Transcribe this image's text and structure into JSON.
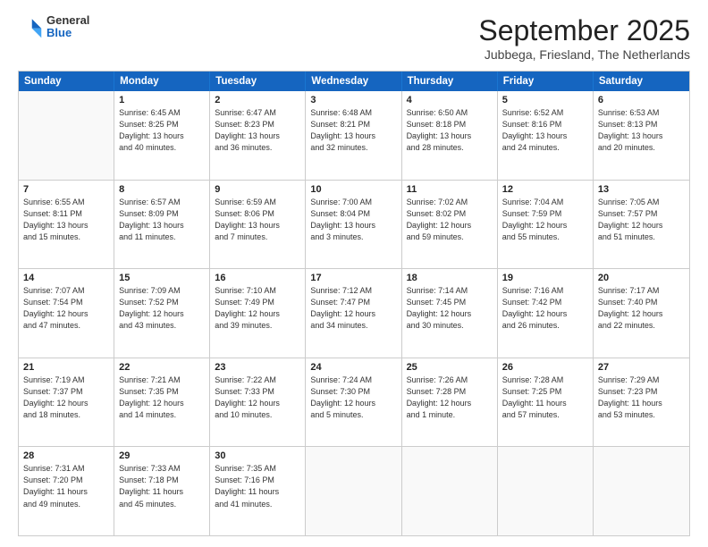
{
  "header": {
    "logo_general": "General",
    "logo_blue": "Blue",
    "month_title": "September 2025",
    "subtitle": "Jubbega, Friesland, The Netherlands"
  },
  "weekdays": [
    "Sunday",
    "Monday",
    "Tuesday",
    "Wednesday",
    "Thursday",
    "Friday",
    "Saturday"
  ],
  "rows": [
    [
      {
        "day": "",
        "info": ""
      },
      {
        "day": "1",
        "info": "Sunrise: 6:45 AM\nSunset: 8:25 PM\nDaylight: 13 hours\nand 40 minutes."
      },
      {
        "day": "2",
        "info": "Sunrise: 6:47 AM\nSunset: 8:23 PM\nDaylight: 13 hours\nand 36 minutes."
      },
      {
        "day": "3",
        "info": "Sunrise: 6:48 AM\nSunset: 8:21 PM\nDaylight: 13 hours\nand 32 minutes."
      },
      {
        "day": "4",
        "info": "Sunrise: 6:50 AM\nSunset: 8:18 PM\nDaylight: 13 hours\nand 28 minutes."
      },
      {
        "day": "5",
        "info": "Sunrise: 6:52 AM\nSunset: 8:16 PM\nDaylight: 13 hours\nand 24 minutes."
      },
      {
        "day": "6",
        "info": "Sunrise: 6:53 AM\nSunset: 8:13 PM\nDaylight: 13 hours\nand 20 minutes."
      }
    ],
    [
      {
        "day": "7",
        "info": "Sunrise: 6:55 AM\nSunset: 8:11 PM\nDaylight: 13 hours\nand 15 minutes."
      },
      {
        "day": "8",
        "info": "Sunrise: 6:57 AM\nSunset: 8:09 PM\nDaylight: 13 hours\nand 11 minutes."
      },
      {
        "day": "9",
        "info": "Sunrise: 6:59 AM\nSunset: 8:06 PM\nDaylight: 13 hours\nand 7 minutes."
      },
      {
        "day": "10",
        "info": "Sunrise: 7:00 AM\nSunset: 8:04 PM\nDaylight: 13 hours\nand 3 minutes."
      },
      {
        "day": "11",
        "info": "Sunrise: 7:02 AM\nSunset: 8:02 PM\nDaylight: 12 hours\nand 59 minutes."
      },
      {
        "day": "12",
        "info": "Sunrise: 7:04 AM\nSunset: 7:59 PM\nDaylight: 12 hours\nand 55 minutes."
      },
      {
        "day": "13",
        "info": "Sunrise: 7:05 AM\nSunset: 7:57 PM\nDaylight: 12 hours\nand 51 minutes."
      }
    ],
    [
      {
        "day": "14",
        "info": "Sunrise: 7:07 AM\nSunset: 7:54 PM\nDaylight: 12 hours\nand 47 minutes."
      },
      {
        "day": "15",
        "info": "Sunrise: 7:09 AM\nSunset: 7:52 PM\nDaylight: 12 hours\nand 43 minutes."
      },
      {
        "day": "16",
        "info": "Sunrise: 7:10 AM\nSunset: 7:49 PM\nDaylight: 12 hours\nand 39 minutes."
      },
      {
        "day": "17",
        "info": "Sunrise: 7:12 AM\nSunset: 7:47 PM\nDaylight: 12 hours\nand 34 minutes."
      },
      {
        "day": "18",
        "info": "Sunrise: 7:14 AM\nSunset: 7:45 PM\nDaylight: 12 hours\nand 30 minutes."
      },
      {
        "day": "19",
        "info": "Sunrise: 7:16 AM\nSunset: 7:42 PM\nDaylight: 12 hours\nand 26 minutes."
      },
      {
        "day": "20",
        "info": "Sunrise: 7:17 AM\nSunset: 7:40 PM\nDaylight: 12 hours\nand 22 minutes."
      }
    ],
    [
      {
        "day": "21",
        "info": "Sunrise: 7:19 AM\nSunset: 7:37 PM\nDaylight: 12 hours\nand 18 minutes."
      },
      {
        "day": "22",
        "info": "Sunrise: 7:21 AM\nSunset: 7:35 PM\nDaylight: 12 hours\nand 14 minutes."
      },
      {
        "day": "23",
        "info": "Sunrise: 7:22 AM\nSunset: 7:33 PM\nDaylight: 12 hours\nand 10 minutes."
      },
      {
        "day": "24",
        "info": "Sunrise: 7:24 AM\nSunset: 7:30 PM\nDaylight: 12 hours\nand 5 minutes."
      },
      {
        "day": "25",
        "info": "Sunrise: 7:26 AM\nSunset: 7:28 PM\nDaylight: 12 hours\nand 1 minute."
      },
      {
        "day": "26",
        "info": "Sunrise: 7:28 AM\nSunset: 7:25 PM\nDaylight: 11 hours\nand 57 minutes."
      },
      {
        "day": "27",
        "info": "Sunrise: 7:29 AM\nSunset: 7:23 PM\nDaylight: 11 hours\nand 53 minutes."
      }
    ],
    [
      {
        "day": "28",
        "info": "Sunrise: 7:31 AM\nSunset: 7:20 PM\nDaylight: 11 hours\nand 49 minutes."
      },
      {
        "day": "29",
        "info": "Sunrise: 7:33 AM\nSunset: 7:18 PM\nDaylight: 11 hours\nand 45 minutes."
      },
      {
        "day": "30",
        "info": "Sunrise: 7:35 AM\nSunset: 7:16 PM\nDaylight: 11 hours\nand 41 minutes."
      },
      {
        "day": "",
        "info": ""
      },
      {
        "day": "",
        "info": ""
      },
      {
        "day": "",
        "info": ""
      },
      {
        "day": "",
        "info": ""
      }
    ]
  ]
}
